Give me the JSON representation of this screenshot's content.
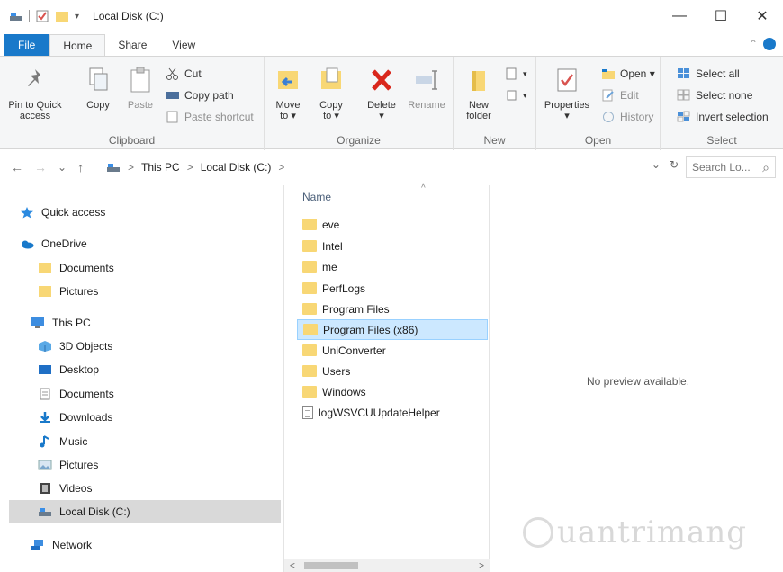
{
  "window": {
    "title": "Local Disk (C:)",
    "controls": {
      "minimize": "—",
      "maximize": "☐",
      "close": "✕"
    }
  },
  "tabs": [
    {
      "label": "File"
    },
    {
      "label": "Home"
    },
    {
      "label": "Share"
    },
    {
      "label": "View"
    }
  ],
  "ribbon": {
    "clipboard": {
      "label": "Clipboard",
      "pin_line1": "Pin to Quick",
      "pin_line2": "access",
      "copy": "Copy",
      "paste": "Paste",
      "cut": "Cut",
      "copy_path": "Copy path",
      "paste_shortcut": "Paste shortcut"
    },
    "organize": {
      "label": "Organize",
      "move_line1": "Move",
      "move_line2": "to ▾",
      "copy_line1": "Copy",
      "copy_line2": "to ▾",
      "delete": "Delete",
      "delete_arrow": "▾",
      "rename": "Rename"
    },
    "new": {
      "label": "New",
      "folder_line1": "New",
      "folder_line2": "folder"
    },
    "open": {
      "label": "Open",
      "properties": "Properties",
      "properties_arrow": "▾",
      "open": "Open ▾",
      "edit": "Edit",
      "history": "History"
    },
    "select": {
      "label": "Select",
      "select_all": "Select all",
      "select_none": "Select none",
      "invert": "Invert selection"
    }
  },
  "address": {
    "back": "←",
    "forward": "→",
    "recent": "⌄",
    "up": "↑",
    "crumbs": [
      "This PC",
      "Local Disk (C:)"
    ],
    "sep": ">",
    "dropdown": "⌄",
    "refresh": "↻",
    "search_placeholder": "Search Lo...",
    "search_icon": "⌕"
  },
  "nav": [
    {
      "label": "Quick access",
      "icon": "star-icon"
    },
    {
      "label": "OneDrive",
      "icon": "cloud-icon"
    },
    {
      "label": "Documents",
      "icon": "folder-icon"
    },
    {
      "label": "Pictures",
      "icon": "folder-icon"
    },
    {
      "label": "This PC",
      "icon": "computer-icon"
    },
    {
      "label": "3D Objects",
      "icon": "cube-icon"
    },
    {
      "label": "Desktop",
      "icon": "desktop-icon"
    },
    {
      "label": "Documents",
      "icon": "documents-icon"
    },
    {
      "label": "Downloads",
      "icon": "download-icon"
    },
    {
      "label": "Music",
      "icon": "music-icon"
    },
    {
      "label": "Pictures",
      "icon": "pictures-icon"
    },
    {
      "label": "Videos",
      "icon": "videos-icon"
    },
    {
      "label": "Local Disk (C:)",
      "icon": "drive-icon",
      "selected": true
    },
    {
      "label": "Network",
      "icon": "network-icon"
    }
  ],
  "filelist": {
    "column_name": "Name",
    "sort_arrow": "^",
    "items": [
      {
        "name": "eve",
        "type": "folder"
      },
      {
        "name": "Intel",
        "type": "folder"
      },
      {
        "name": "me",
        "type": "folder"
      },
      {
        "name": "PerfLogs",
        "type": "folder"
      },
      {
        "name": "Program Files",
        "type": "folder"
      },
      {
        "name": "Program Files (x86)",
        "type": "folder",
        "selected": true
      },
      {
        "name": "UniConverter",
        "type": "folder"
      },
      {
        "name": "Users",
        "type": "folder"
      },
      {
        "name": "Windows",
        "type": "folder"
      },
      {
        "name": "logWSVCUUpdateHelper",
        "type": "file"
      }
    ],
    "scroll_left": "<",
    "scroll_right": ">"
  },
  "preview": {
    "text": "No preview available.",
    "watermark": "uantrimang"
  }
}
